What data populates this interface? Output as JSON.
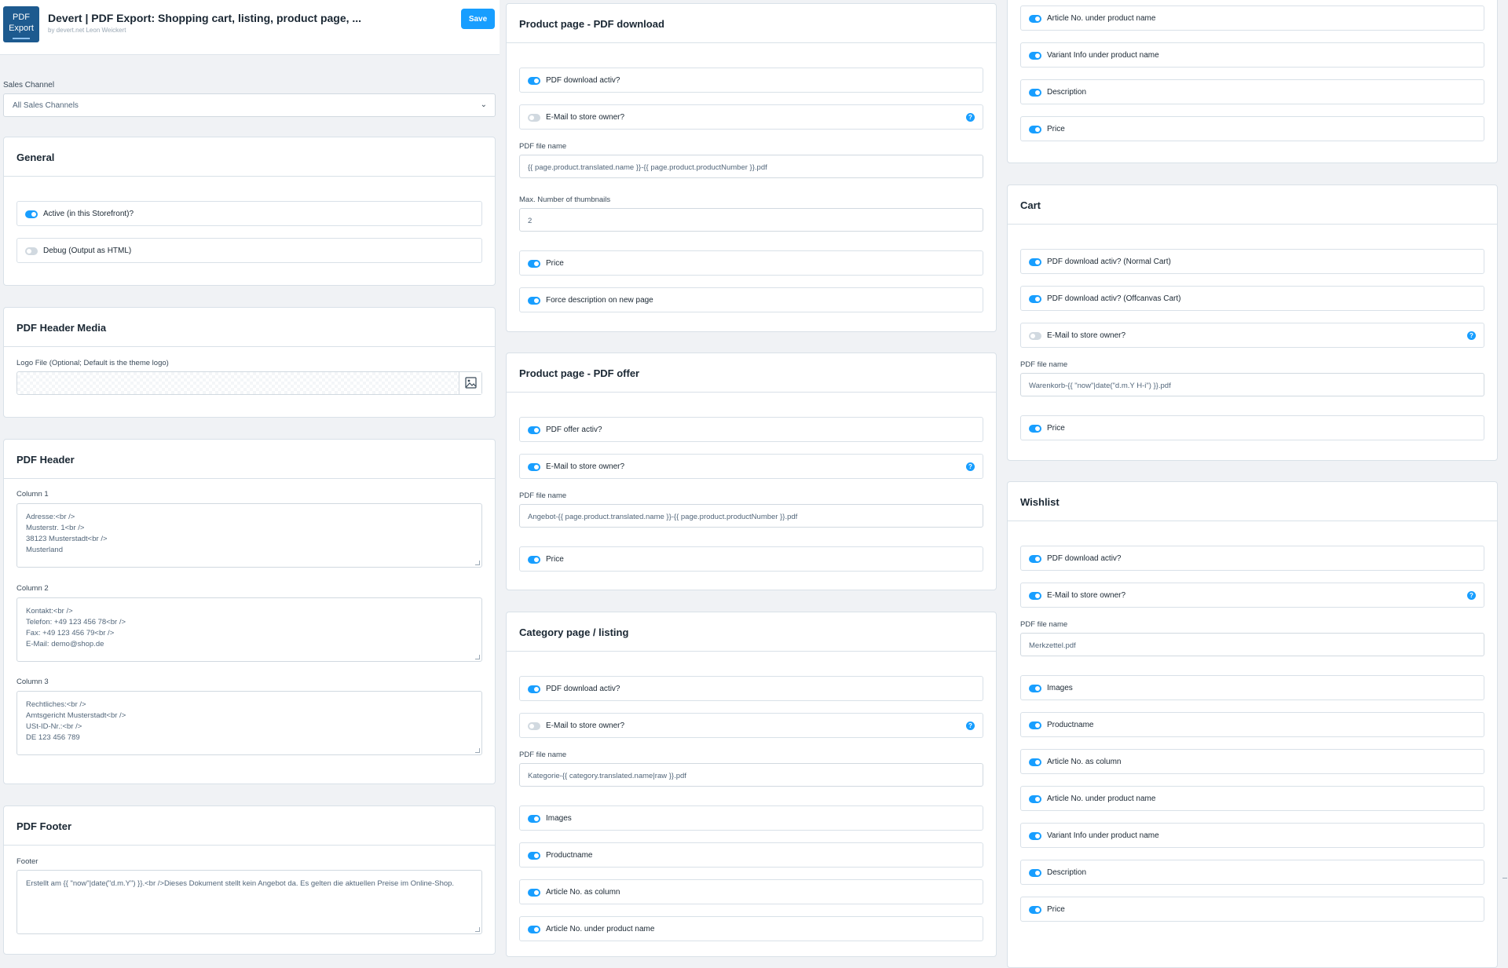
{
  "header": {
    "logo_line1": "PDF",
    "logo_line2": "Export",
    "title": "Devert | PDF Export: Shopping cart, listing, product page, ...",
    "subtitle": "by devert.net Leon Weickert",
    "save_label": "Save"
  },
  "sales_channel": {
    "label": "Sales Channel",
    "value": "All Sales Channels"
  },
  "general": {
    "title": "General",
    "active": {
      "label": "Active (in this Storefront)?",
      "on": true
    },
    "debug": {
      "label": "Debug (Output as HTML)",
      "on": false
    }
  },
  "header_media": {
    "title": "PDF Header Media",
    "logo_label": "Logo File (Optional; Default is the theme logo)"
  },
  "pdf_header": {
    "title": "PDF Header",
    "column1": {
      "label": "Column 1",
      "lines": [
        "Adresse:<br />",
        "Musterstr. 1<br />",
        "38123 Musterstadt<br />",
        "Musterland"
      ]
    },
    "column2": {
      "label": "Column 2",
      "lines": [
        "Kontakt:<br />",
        "Telefon: +49 123 456 78<br />",
        "Fax: +49 123 456 79<br />",
        "E-Mail: demo@shop.de"
      ]
    },
    "column3": {
      "label": "Column 3",
      "lines": [
        "Rechtliches:<br />",
        "Amtsgericht Musterstadt<br />",
        "USt-ID-Nr.:<br />",
        "DE 123 456 789"
      ]
    }
  },
  "pdf_footer": {
    "title": "PDF Footer",
    "footer_label": "Footer",
    "footer_value": "Erstellt am {{ \"now\"|date(\"d.m.Y\") }}.<br />Dieses Dokument stellt kein Angebot da. Es gelten die aktuellen Preise im Online-Shop."
  },
  "product_download": {
    "title": "Product page - PDF download",
    "activ": {
      "label": "PDF download activ?",
      "on": true
    },
    "email": {
      "label": "E-Mail to store owner?",
      "on": false
    },
    "filename_label": "PDF file name",
    "filename_value": "{{ page.product.translated.name }}-{{ page.product.productNumber }}.pdf",
    "thumbs_label": "Max. Number of thumbnails",
    "thumbs_value": "2",
    "price": {
      "label": "Price",
      "on": true
    },
    "force": {
      "label": "Force description on new page",
      "on": true
    }
  },
  "product_offer": {
    "title": "Product page - PDF offer",
    "activ": {
      "label": "PDF offer activ?",
      "on": true
    },
    "email": {
      "label": "E-Mail to store owner?",
      "on": true
    },
    "filename_label": "PDF file name",
    "filename_value": "Angebot-{{ page.product.translated.name }}-{{ page.product.productNumber }}.pdf",
    "price": {
      "label": "Price",
      "on": true
    }
  },
  "category": {
    "title": "Category page / listing",
    "activ": {
      "label": "PDF download activ?",
      "on": true
    },
    "email": {
      "label": "E-Mail to store owner?",
      "on": false
    },
    "filename_label": "PDF file name",
    "filename_value": "Kategorie-{{ category.translated.name|raw }}.pdf",
    "images": {
      "label": "Images",
      "on": true
    },
    "productname": {
      "label": "Productname",
      "on": true
    },
    "article_col": {
      "label": "Article No. as column",
      "on": true
    },
    "article_under": {
      "label": "Article No. under product name",
      "on": true
    }
  },
  "listing_cont": {
    "article_under": {
      "label": "Article No. under product name",
      "on": true
    },
    "variant": {
      "label": "Variant Info under product name",
      "on": true
    },
    "description": {
      "label": "Description",
      "on": true
    },
    "price": {
      "label": "Price",
      "on": true
    }
  },
  "cart": {
    "title": "Cart",
    "normal": {
      "label": "PDF download activ? (Normal Cart)",
      "on": true
    },
    "offcanvas": {
      "label": "PDF download activ? (Offcanvas Cart)",
      "on": true
    },
    "email": {
      "label": "E-Mail to store owner?",
      "on": false
    },
    "filename_label": "PDF file name",
    "filename_value": "Warenkorb-{{ \"now\"|date(\"d.m.Y H-i\") }}.pdf",
    "price": {
      "label": "Price",
      "on": true
    }
  },
  "wishlist": {
    "title": "Wishlist",
    "activ": {
      "label": "PDF download activ?",
      "on": true
    },
    "email": {
      "label": "E-Mail to store owner?",
      "on": true
    },
    "filename_label": "PDF file name",
    "filename_value": "Merkzettel.pdf",
    "images": {
      "label": "Images",
      "on": true
    },
    "productname": {
      "label": "Productname",
      "on": true
    },
    "article_col": {
      "label": "Article No. as column",
      "on": true
    },
    "article_under": {
      "label": "Article No. under product name",
      "on": true
    },
    "variant": {
      "label": "Variant Info under product name",
      "on": true
    },
    "description": {
      "label": "Description",
      "on": true
    },
    "price": {
      "label": "Price",
      "on": true
    }
  },
  "icons": {
    "help": "?",
    "select": "chevron-down-icon",
    "media": "image-icon"
  },
  "colors": {
    "accent": "#189eff",
    "logo": "#1d5a8f",
    "toggle_off": "#d1d9e0"
  }
}
